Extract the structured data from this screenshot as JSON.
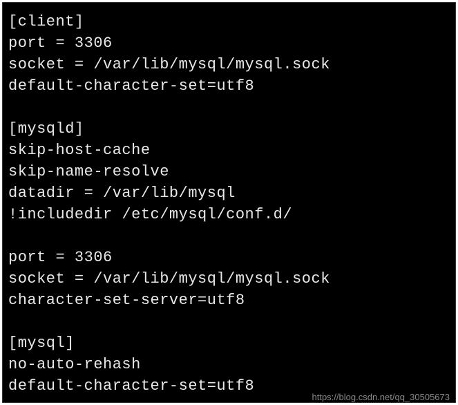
{
  "config": {
    "lines": [
      "[client]",
      "port = 3306",
      "socket = /var/lib/mysql/mysql.sock",
      "default-character-set=utf8",
      "",
      "[mysqld]",
      "skip-host-cache",
      "skip-name-resolve",
      "datadir = /var/lib/mysql",
      "!includedir /etc/mysql/conf.d/",
      "",
      "port = 3306",
      "socket = /var/lib/mysql/mysql.sock",
      "character-set-server=utf8",
      "",
      "[mysql]",
      "no-auto-rehash",
      "default-character-set=utf8"
    ]
  },
  "watermark": {
    "text": "https://blog.csdn.net/qq_30505673",
    "brand": "CSDN"
  }
}
